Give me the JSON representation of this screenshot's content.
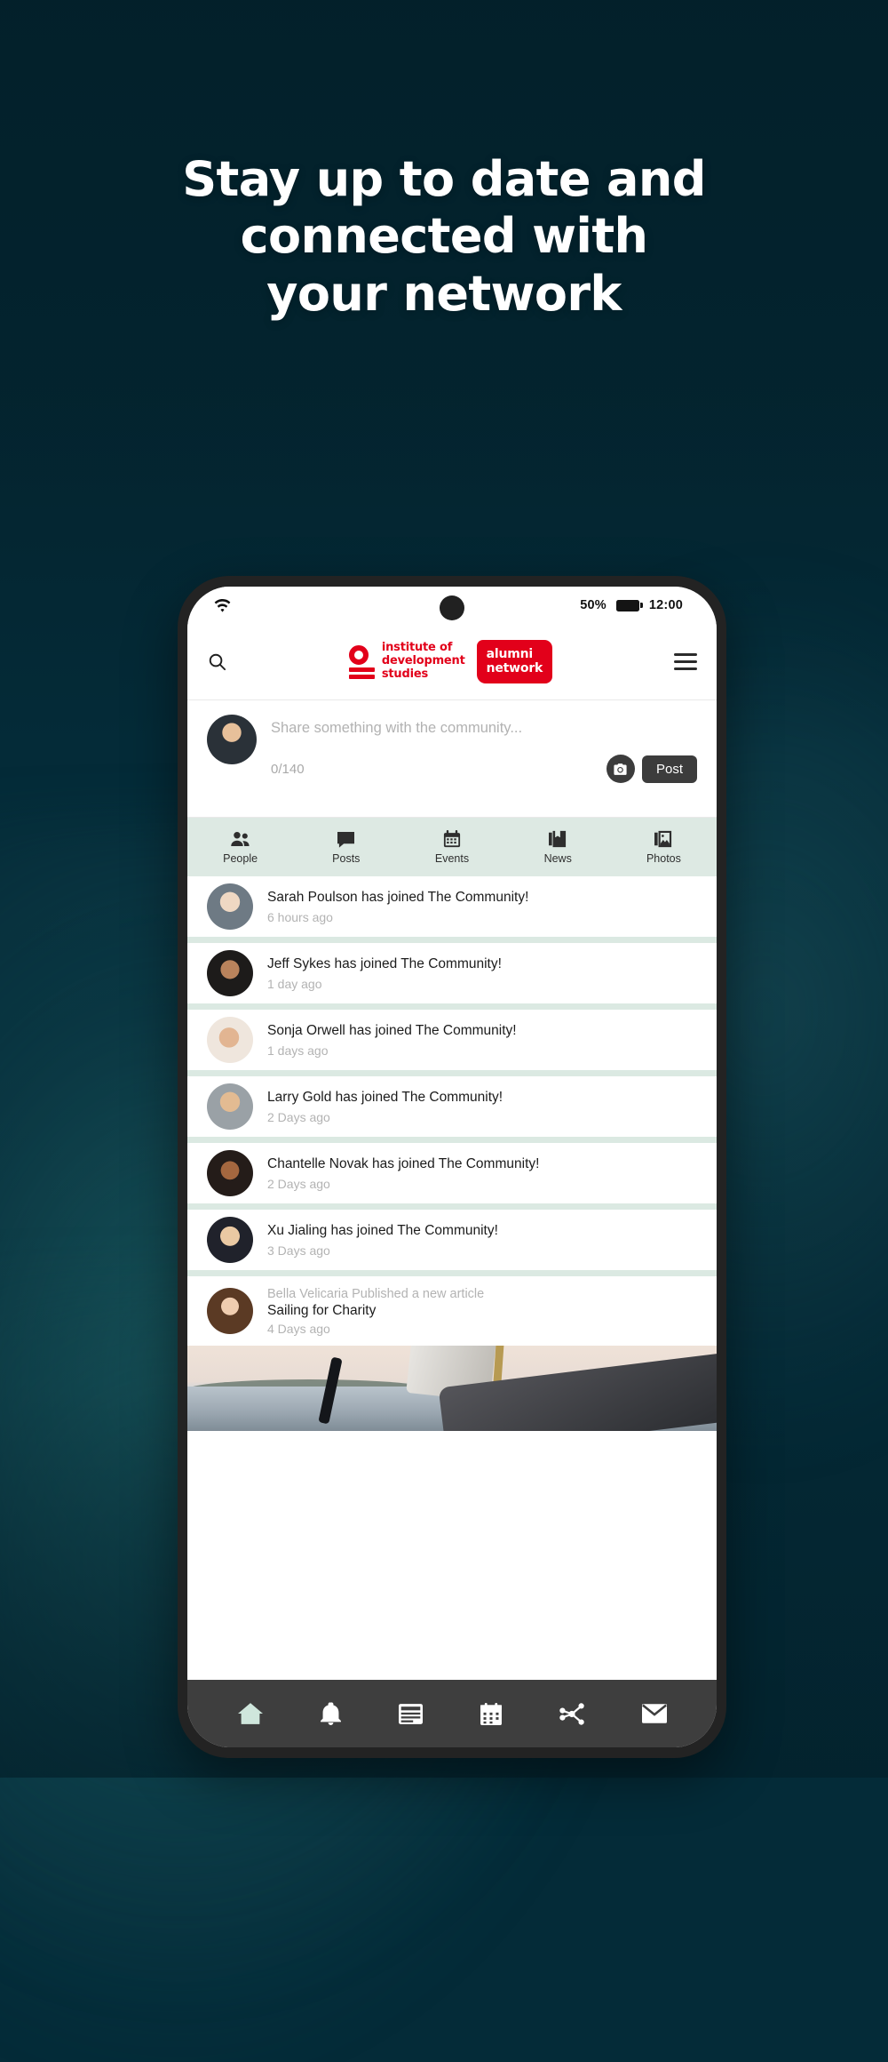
{
  "headline": {
    "lines": [
      "Stay up to date and",
      "connected with",
      "your network"
    ]
  },
  "colors": {
    "background": "#042b38",
    "brand_red": "#e2001a",
    "tab_bar_bg": "#dde9e3",
    "separator": "#dbe9e2",
    "bottom_nav_bg": "#3e3e3e",
    "active_nav": "#cfe6dc",
    "post_button_bg": "#3c3c3c"
  },
  "phone": {
    "status_bar": {
      "wifi_icon": "wifi-icon",
      "battery_percent": "50%",
      "battery_icon": "battery-icon",
      "clock": "12:00"
    },
    "app_bar": {
      "search_icon": "search-icon",
      "logo": {
        "ids_mark": "ids-logo-mark",
        "ids_text_lines": [
          "institute of",
          "development",
          "studies"
        ],
        "alumni_lines": [
          "alumni",
          "network"
        ]
      },
      "menu_icon": "hamburger-menu-icon"
    },
    "compose": {
      "avatar": "user-avatar",
      "placeholder": "Share something with the community...",
      "counter": "0/140",
      "camera_icon": "camera-icon",
      "post_label": "Post"
    },
    "tabs": [
      {
        "label": "People",
        "icon": "people-icon"
      },
      {
        "label": "Posts",
        "icon": "comment-icon"
      },
      {
        "label": "Events",
        "icon": "calendar-icon"
      },
      {
        "label": "News",
        "icon": "book-icon"
      },
      {
        "label": "Photos",
        "icon": "photos-icon"
      }
    ],
    "feed": [
      {
        "title": "Sarah Poulson has joined The Community!",
        "time": "6 hours ago",
        "face": "f2"
      },
      {
        "title": "Jeff Sykes has joined The Community!",
        "time": "1 day ago",
        "face": "f3"
      },
      {
        "title": "Sonja Orwell has joined The Community!",
        "time": "1 days ago",
        "face": "f4"
      },
      {
        "title": "Larry Gold has joined The Community!",
        "time": "2 Days ago",
        "face": "f5"
      },
      {
        "title": "Chantelle Novak has joined The Community!",
        "time": "2 Days ago",
        "face": "f6"
      },
      {
        "title": "Xu Jialing has joined The Community!",
        "time": "3 Days ago",
        "face": "f7"
      }
    ],
    "article": {
      "pre": "Bella Velicaria Published a new article",
      "title": "Sailing for Charity",
      "time": "4 Days ago",
      "face": "f8",
      "photo_alt": "sailing-boat-photo"
    },
    "bottom_nav": [
      {
        "icon": "home-icon",
        "active": true
      },
      {
        "icon": "bell-icon",
        "active": false
      },
      {
        "icon": "news-icon",
        "active": false
      },
      {
        "icon": "calendar-icon",
        "active": false
      },
      {
        "icon": "network-icon",
        "active": false
      },
      {
        "icon": "mail-icon",
        "active": false
      }
    ]
  }
}
